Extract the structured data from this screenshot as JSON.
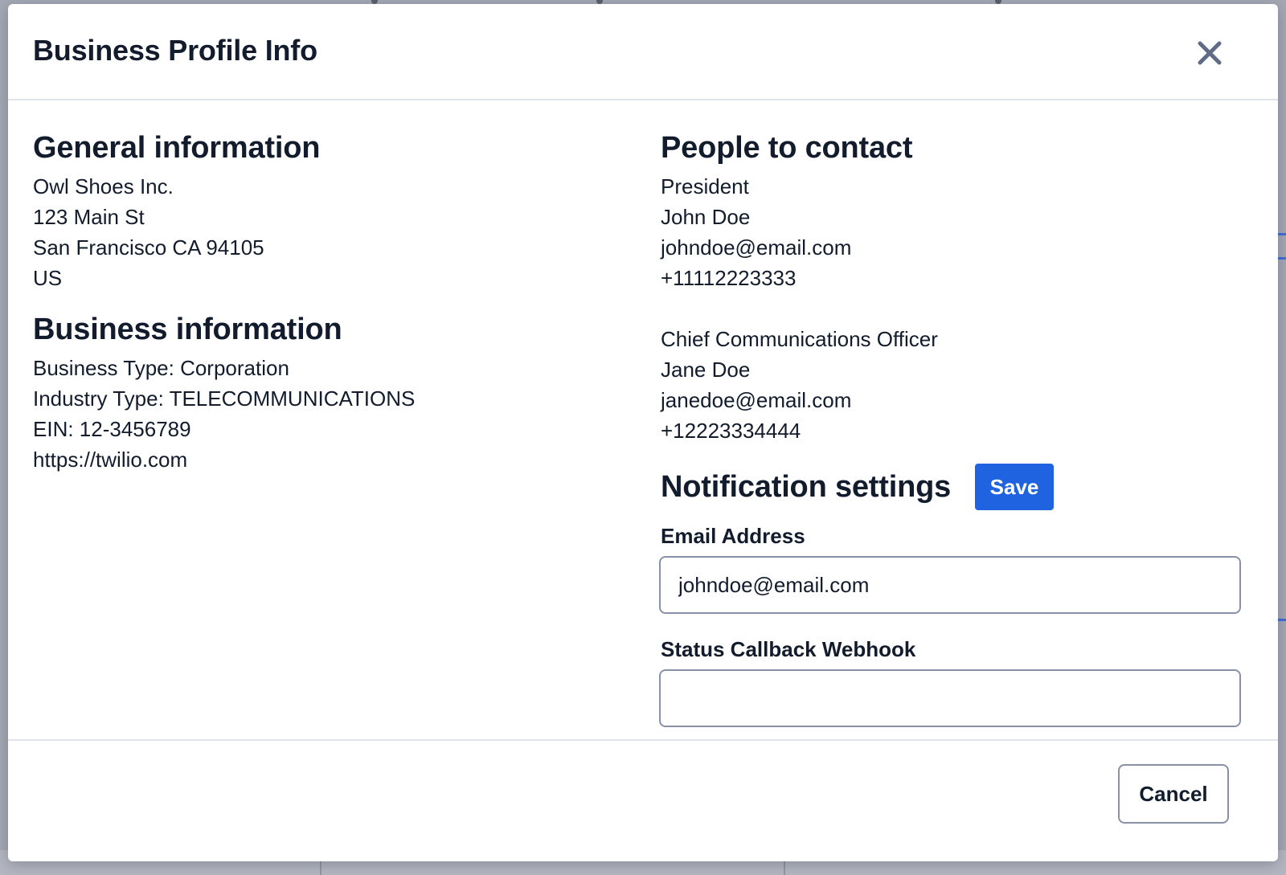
{
  "modal": {
    "title": "Business Profile Info"
  },
  "general": {
    "heading": "General information",
    "lines": [
      "Owl Shoes Inc.",
      "123 Main St",
      "San Francisco CA 94105",
      "US"
    ]
  },
  "business": {
    "heading": "Business information",
    "lines": [
      "Business Type: Corporation",
      "Industry Type: TELECOMMUNICATIONS",
      "EIN: 12-3456789",
      "https://twilio.com"
    ]
  },
  "contacts": {
    "heading": "People to contact",
    "people": [
      {
        "role": "President",
        "name": "John Doe",
        "email": "johndoe@email.com",
        "phone": "+11112223333"
      },
      {
        "role": "Chief Communications Officer",
        "name": "Jane Doe",
        "email": "janedoe@email.com",
        "phone": "+12223334444"
      }
    ]
  },
  "notifications": {
    "heading": "Notification settings",
    "save_label": "Save",
    "email_label": "Email Address",
    "email_value": "johndoe@email.com",
    "webhook_label": "Status Callback Webhook",
    "webhook_value": ""
  },
  "footer": {
    "cancel_label": "Cancel"
  },
  "icons": {
    "close": "close-icon"
  },
  "colors": {
    "primary": "#1f63e0",
    "text": "#121c2d",
    "close_icon": "#606b85",
    "border": "#8891aa"
  }
}
